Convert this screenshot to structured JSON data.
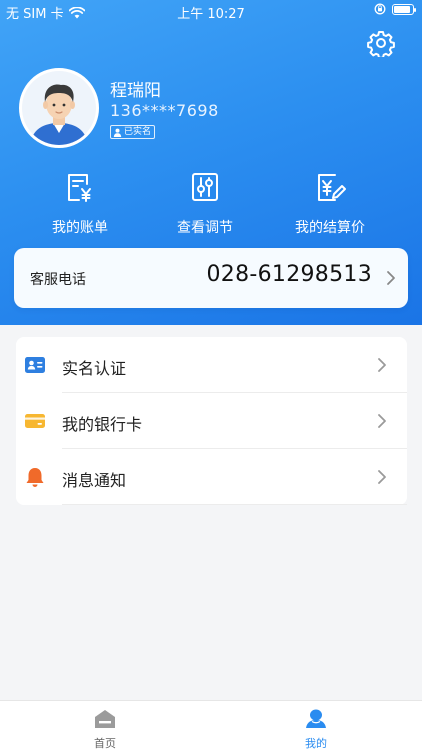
{
  "status_bar": {
    "carrier": "无 SIM 卡",
    "time": "上午 10:27"
  },
  "colors": {
    "brand_blue": "#2c8ff0",
    "tab_active": "#2a8cf0",
    "bell_orange": "#f06a2a",
    "card_yellow": "#f7b731"
  },
  "user": {
    "name": "程瑞阳",
    "phone": "136****7698",
    "verified_label": "已实名"
  },
  "quick_actions": [
    {
      "label": "我的账单",
      "icon": "bill-icon"
    },
    {
      "label": "查看调节",
      "icon": "adjust-icon"
    },
    {
      "label": "我的结算价",
      "icon": "settlement-price-icon"
    }
  ],
  "service": {
    "label": "客服电话",
    "phone": "028-61298513"
  },
  "menu": [
    {
      "label": "实名认证",
      "icon": "id-card-icon"
    },
    {
      "label": "我的银行卡",
      "icon": "bank-card-icon"
    },
    {
      "label": "消息通知",
      "icon": "bell-icon"
    }
  ],
  "tabbar": {
    "home": "首页",
    "mine": "我的",
    "active": "mine"
  }
}
